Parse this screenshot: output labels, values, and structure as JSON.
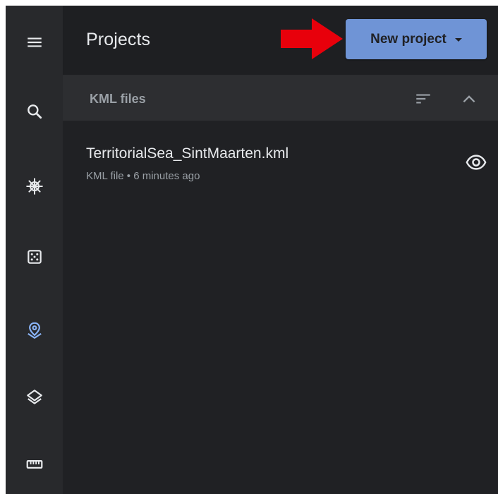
{
  "rail": {
    "items": [
      {
        "name": "menu-icon"
      },
      {
        "name": "search-icon"
      },
      {
        "name": "ship-wheel-icon"
      },
      {
        "name": "dice-icon"
      },
      {
        "name": "place-marker-icon",
        "active": true
      },
      {
        "name": "layers-icon"
      },
      {
        "name": "ruler-icon"
      }
    ],
    "active_color": "#8ab4f8",
    "icon_color": "#e8eaed"
  },
  "header": {
    "title": "Projects",
    "new_project_label": "New project",
    "button_color": "#6f94d6",
    "annotation_arrow_color": "#e8000b"
  },
  "section": {
    "title": "KML files"
  },
  "files": [
    {
      "name": "TerritorialSea_SintMaarten.kml",
      "meta": "KML file • 6 minutes ago"
    }
  ]
}
